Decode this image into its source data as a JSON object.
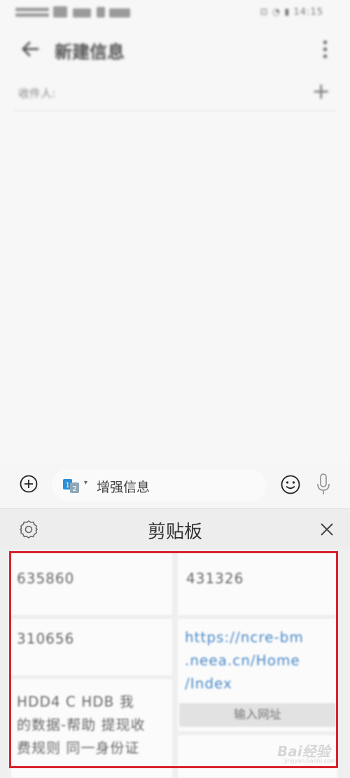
{
  "status_bar": {
    "right_text": "⊡ ◔ ▮ 14:15"
  },
  "header": {
    "title": "新建信息"
  },
  "recipient": {
    "label": "收件人:",
    "add_symbol": "+"
  },
  "compose": {
    "sim_badge": "12",
    "placeholder": "增强信息"
  },
  "clipboard": {
    "title": "剪贴板",
    "items": [
      {
        "text": "635860"
      },
      {
        "text": "431326"
      },
      {
        "text": "310656"
      },
      {
        "text": "https://ncre-bm.neea.cn/Home/Index",
        "line1": "https://ncre-bm",
        "line2": ".neea.cn/Home",
        "line3": "/Index",
        "action": "输入网址"
      },
      {
        "line1": "HDD4 C HDB 我",
        "line2": "的数据-帮助 提现收",
        "line3": "费规则 同一身份证"
      }
    ]
  },
  "watermark": {
    "text": "Bai经验",
    "sub": "jingyan.baidu.com"
  }
}
